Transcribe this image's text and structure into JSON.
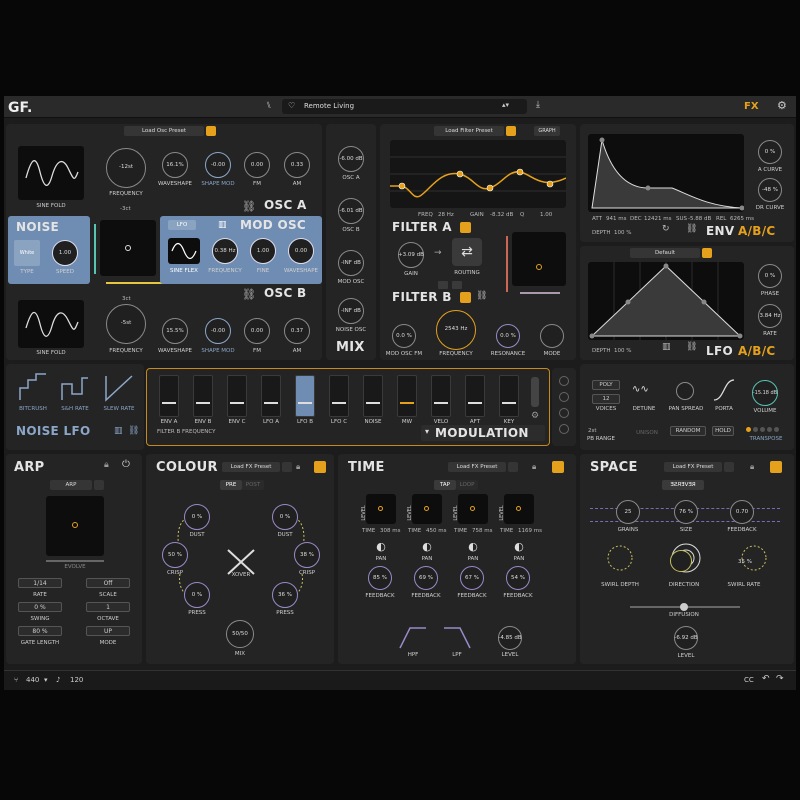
{
  "header": {
    "logo": "GF.",
    "preset_name": "Remote Living",
    "fx": "FX"
  },
  "osc": {
    "preset": "Load Osc Preset",
    "osc_a": "OSC A",
    "osc_b": "OSC B",
    "mod_osc": "MOD OSC",
    "noise": "NOISE",
    "a_shape": "SINE FOLD",
    "a_freq_val": "-12st",
    "a_freq": "FREQUENCY",
    "a_ws_val": "16.1%",
    "a_ws": "WAVESHAPE",
    "a_sm_val": "-0.00",
    "a_sm": "SHAPE MOD",
    "a_fm_val": "0.00",
    "a_fm": "FM",
    "a_am_val": "0.33",
    "a_am": "AM",
    "a_oct": "-3ct",
    "noise_type_val": "White",
    "noise_type": "TYPE",
    "noise_speed_val": "1.00",
    "noise_speed": "SPEED",
    "mod_lfo": "LFO",
    "mod_shape": "SINE FLEX",
    "mod_freq_val": "0.38 Hz",
    "mod_freq": "FREQUENCY",
    "mod_fine_val": "1.00",
    "mod_fine": "FINE",
    "mod_ws_val": "0.00",
    "mod_ws": "WAVESHAPE",
    "b_shape": "SINE FOLD",
    "b_oct": "3ct",
    "b_freq_val": "-5st",
    "b_freq": "FREQUENCY",
    "b_ws_val": "15.5%",
    "b_ws": "WAVESHAPE",
    "b_sm_val": "-0.00",
    "b_sm": "SHAPE MOD",
    "b_fm_val": "0.00",
    "b_fm": "FM",
    "b_am_val": "0.37",
    "b_am": "AM"
  },
  "mix": {
    "title": "MIX",
    "osc_a_val": "-6.00 dB",
    "osc_a": "OSC A",
    "osc_b_val": "-6.01 dB",
    "osc_b": "OSC B",
    "mod_val": "-INF dB",
    "mod": "MOD OSC",
    "noise_val": "-INF dB",
    "noise": "NOISE OSC"
  },
  "filter": {
    "preset": "Load Filter Preset",
    "graph": "GRAPH",
    "freq_lbl": "FREQ",
    "freq_val": "28 Hz",
    "gain_lbl": "GAIN",
    "gain_val": "-8.32 dB",
    "q_lbl": "Q",
    "q_val": "1.00",
    "a": "FILTER A",
    "b": "FILTER B",
    "gain_knob_val": "+3.09 dB",
    "gain_knob": "GAIN",
    "routing": "ROUTING",
    "mod_fm_val": "0.0 %",
    "mod_fm": "MOD OSC FM",
    "freq2_val": "2543 Hz",
    "freq2": "FREQUENCY",
    "res_val": "0.0 %",
    "res": "RESONANCE",
    "mode": "MODE"
  },
  "env": {
    "a_curve_val": "0 %",
    "a_curve": "A CURVE",
    "dr_curve_val": "-48 %",
    "dr_curve": "DR CURVE",
    "att": "ATT",
    "att_val": "941 ms",
    "dec": "DEC",
    "dec_val": "12421 ms",
    "sus": "SUS",
    "sus_val": "-5.88 dB",
    "rel": "REL",
    "rel_val": "6265 ms",
    "depth": "DEPTH",
    "depth_val": "100 %",
    "title": "ENV",
    "abc": "A/B/C"
  },
  "lfo": {
    "preset": "Default",
    "phase_val": "0 %",
    "phase": "PHASE",
    "rate_val": "3.84 Hz",
    "rate": "RATE",
    "depth": "DEPTH",
    "depth_val": "100 %",
    "title": "LFO",
    "abc": "A/B/C"
  },
  "noiselfo": {
    "bitcrush": "BITCRUSH",
    "sh": "S&H RATE",
    "slew": "SLEW RATE",
    "title": "NOISE LFO"
  },
  "modulation": {
    "slots": [
      "ENV A",
      "ENV B",
      "ENV C",
      "LFO A",
      "LFO B",
      "LFO C",
      "NOISE",
      "MW",
      "VELO",
      "AFT",
      "KEY"
    ],
    "target": "FILTER B FREQUENCY",
    "title": "MODULATION"
  },
  "voice": {
    "poly": "POLY",
    "voices_val": "12",
    "voices": "VOICES",
    "detune": "DETUNE",
    "pan_spread": "PAN SPREAD",
    "porta": "PORTA",
    "volume_val": "-15.18 dB",
    "volume": "VOLUME",
    "pb_val": "2st",
    "pb": "PB RANGE",
    "unison": "UNISON",
    "random": "RANDOM",
    "hold": "HOLD",
    "transpose": "TRANSPOSE"
  },
  "arp": {
    "title": "ARP",
    "mode_btn": "ARP",
    "evolve": "EVOLVE",
    "rate_val": "1/14",
    "rate": "RATE",
    "scale_val": "Off",
    "scale": "SCALE",
    "swing_val": "0 %",
    "swing": "SWING",
    "octave_val": "1",
    "octave": "OCTAVE",
    "gate_val": "80 %",
    "gate": "GATE LENGTH",
    "mode_val": "UP",
    "mode": "MODE"
  },
  "colour": {
    "title": "COLOUR",
    "preset": "Load FX Preset",
    "pre": "PRE",
    "post": "POST",
    "dust1_val": "0 %",
    "dust1": "DUST",
    "dust2_val": "0 %",
    "dust2": "DUST",
    "crisp1_val": "50 %",
    "crisp1": "CRISP",
    "crisp2_val": "38 %",
    "crisp2": "CRISP",
    "xover": "XOVER",
    "press1_val": "0 %",
    "press1": "PRESS",
    "press2_val": "36 %",
    "press2": "PRESS",
    "mix_val": "50/50",
    "mix": "MIX"
  },
  "time": {
    "title": "TIME",
    "preset": "Load FX Preset",
    "tap": "TAP",
    "loop": "LOOP",
    "level_lbl": "LEVEL",
    "level_val": "-6.02 dB",
    "time_lbl": "TIME",
    "times": [
      "308 ms",
      "450 ms",
      "758 ms",
      "1169 ms"
    ],
    "pan": "PAN",
    "fb": [
      "85 %",
      "69 %",
      "67 %",
      "54 %"
    ],
    "feedback": "FEEDBACK",
    "hpf": "HPF",
    "lpf": "LPF",
    "level2_val": "-4.85 dB",
    "level2": "LEVEL"
  },
  "space": {
    "title": "SPACE",
    "preset": "Load FX Preset",
    "mode": "REVERSE",
    "grains_val": "25",
    "grains": "GRAINS",
    "size_val": "76 %",
    "size": "SIZE",
    "fb_val": "0.70",
    "fb": "FEEDBACK",
    "swirl_depth": "SWIRL DEPTH",
    "direction": "DIRECTION",
    "swirl_rate_val": "35 %",
    "swirl_rate": "SWIRL RATE",
    "diffusion": "DIFFUSION",
    "level_val": "-6.92 dB",
    "level": "LEVEL"
  },
  "footer": {
    "tuning": "440",
    "bpm": "120",
    "cc": "CC"
  }
}
